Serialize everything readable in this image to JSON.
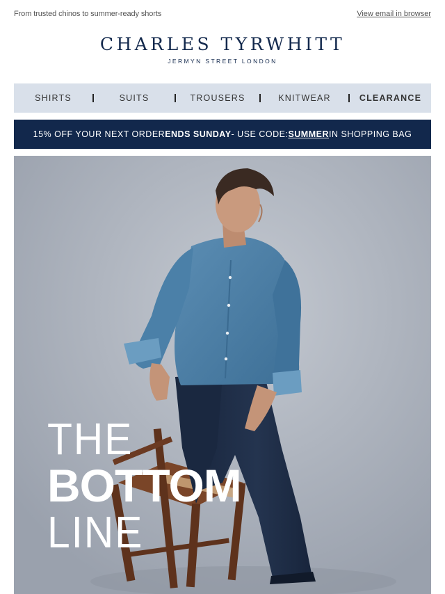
{
  "email": {
    "preheader": "From trusted chinos to summer-ready shorts",
    "view_in_browser": "View email in browser"
  },
  "logo": {
    "brand": "CHARLES TYRWHITT",
    "tagline": "JERMYN STREET LONDON"
  },
  "nav": {
    "items": [
      {
        "label": "SHIRTS"
      },
      {
        "label": "SUITS"
      },
      {
        "label": "TROUSERS"
      },
      {
        "label": "KNITWEAR"
      },
      {
        "label": "CLEARANCE"
      }
    ]
  },
  "promo": {
    "part1": "15% OFF YOUR NEXT ORDER ",
    "part2": "ENDS SUNDAY",
    "part3": " - USE CODE: ",
    "code": "SUMMER",
    "part4": " IN SHOPPING BAG"
  },
  "hero": {
    "line1": "THE",
    "line2": "BOTTOM",
    "line3": "LINE",
    "colors": {
      "shirt": "#4a7fa6",
      "trousers": "#1d2a3f",
      "chair": "#6b3a22",
      "background": "#aab0bb"
    }
  },
  "colors": {
    "navy": "#12284c",
    "nav_bg": "#d9e0ea"
  }
}
